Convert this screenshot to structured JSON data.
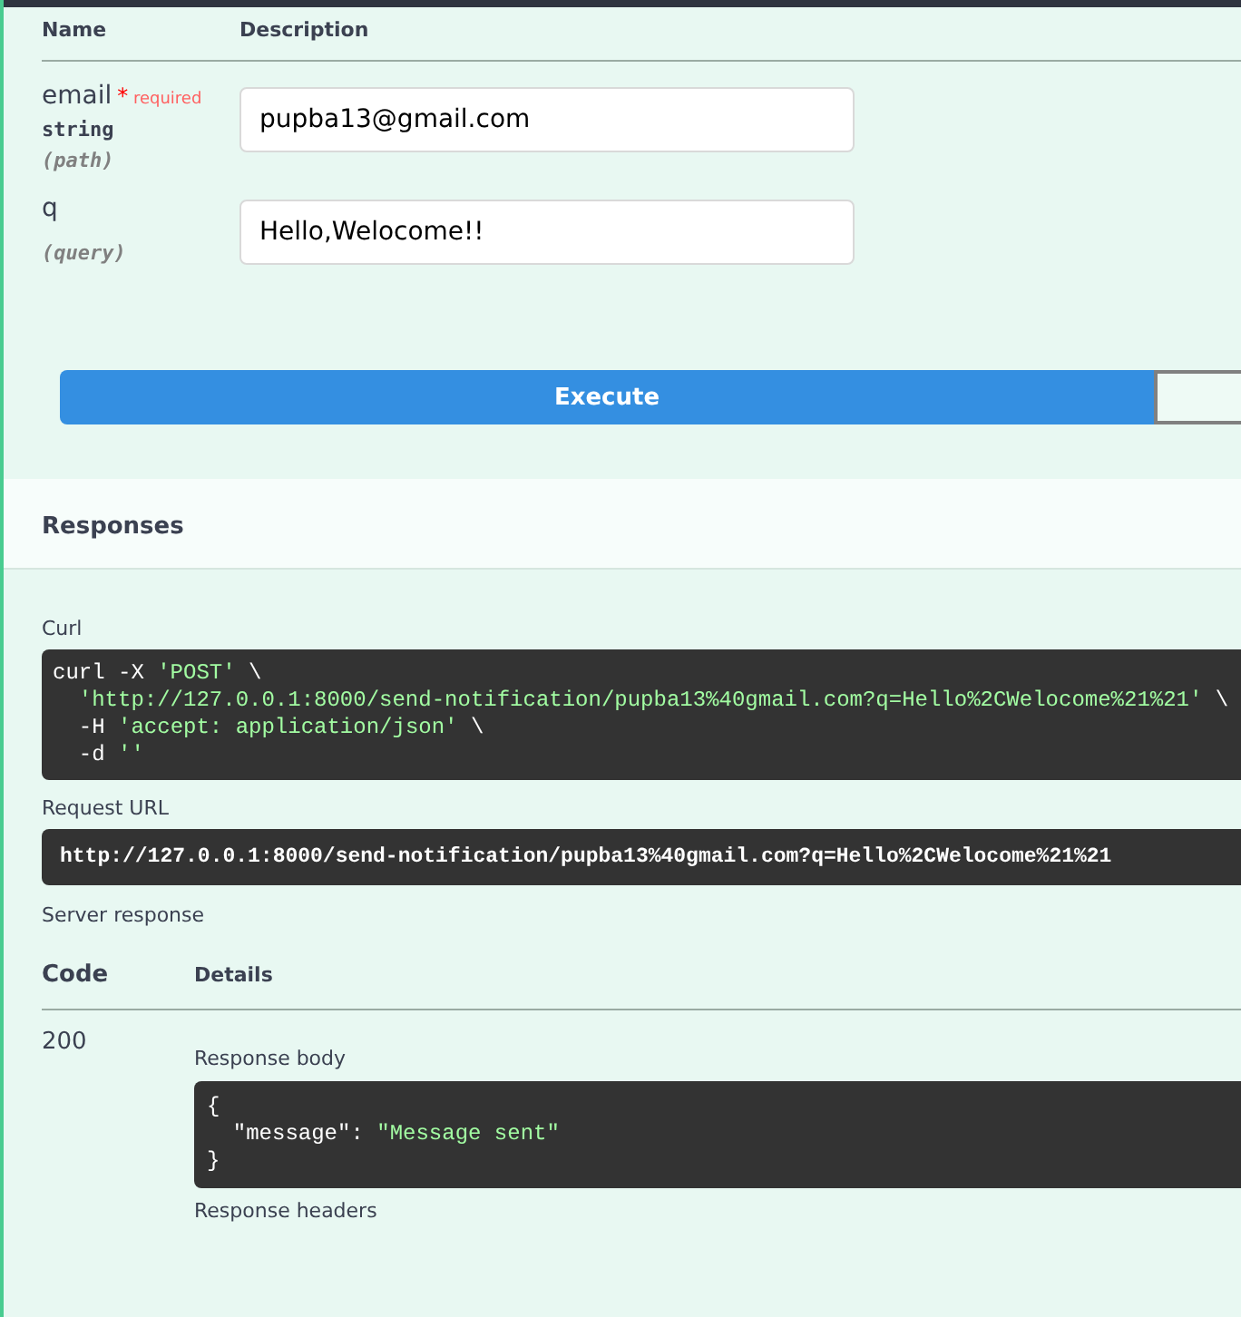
{
  "parameters": {
    "columns": [
      "Name",
      "Description"
    ],
    "rows": [
      {
        "name": "email",
        "required": true,
        "required_mark": "*",
        "required_label": "required",
        "type": "string",
        "location": "(path)",
        "value": "pupba13@gmail.com"
      },
      {
        "name": "q",
        "required": false,
        "type": "",
        "location": "(query)",
        "value": "Hello,Welocome!!"
      }
    ]
  },
  "execute_button": "Execute",
  "responses": {
    "title": "Responses",
    "curl_label": "Curl",
    "curl": [
      [
        {
          "kind": "plain",
          "text": "curl -X "
        },
        {
          "kind": "string",
          "text": "'POST'"
        },
        {
          "kind": "plain",
          "text": " \\"
        }
      ],
      [
        {
          "kind": "string",
          "text": "  'http://127.0.0.1:8000/send-notification/pupba13%40gmail.com?q=Hello%2CWelocome%21%21'"
        },
        {
          "kind": "plain",
          "text": " \\"
        }
      ],
      [
        {
          "kind": "plain",
          "text": "  -H "
        },
        {
          "kind": "string",
          "text": "'accept: application/json'"
        },
        {
          "kind": "plain",
          "text": " \\"
        }
      ],
      [
        {
          "kind": "plain",
          "text": "  -d "
        },
        {
          "kind": "string",
          "text": "''"
        }
      ]
    ],
    "request_url_label": "Request URL",
    "request_url": "http://127.0.0.1:8000/send-notification/pupba13%40gmail.com?q=Hello%2CWelocome%21%21",
    "server_response_label": "Server response",
    "columns": [
      "Code",
      "Details"
    ],
    "code": "200",
    "body_label": "Response body",
    "body": [
      [
        {
          "kind": "plain",
          "text": "{"
        }
      ],
      [
        {
          "kind": "plain",
          "text": "  \"message\": "
        },
        {
          "kind": "string",
          "text": "\"Message sent\""
        }
      ],
      [
        {
          "kind": "plain",
          "text": "}"
        }
      ]
    ],
    "headers_label": "Response headers"
  }
}
